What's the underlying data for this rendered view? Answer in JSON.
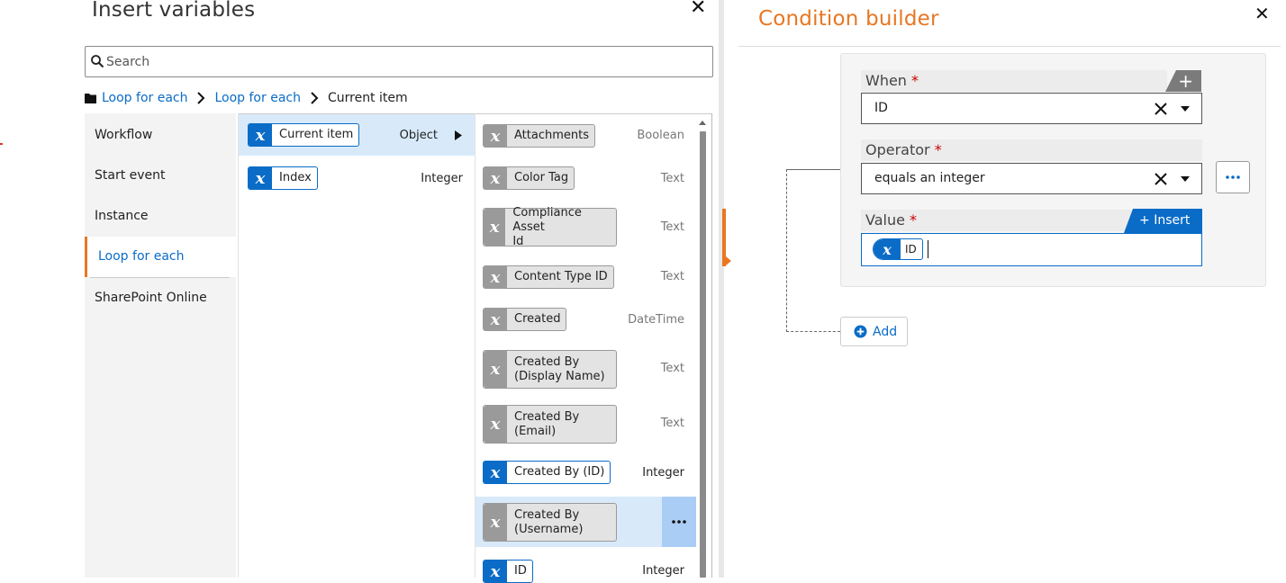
{
  "insert_variables": {
    "title": "Insert variables",
    "search_placeholder": "Search",
    "breadcrumb": [
      "Loop for each",
      "Loop for each",
      "Current item"
    ],
    "nav": [
      "Workflow",
      "Start event",
      "Instance",
      "Loop for each",
      "SharePoint Online"
    ],
    "col2": [
      {
        "label": "Current item",
        "type": "Object"
      },
      {
        "label": "Index",
        "type": "Integer"
      }
    ],
    "col3": [
      {
        "label": "Attachments",
        "type": "Boolean"
      },
      {
        "label": "Color Tag",
        "type": "Text"
      },
      {
        "label_l1": "Compliance Asset",
        "label_l2": "Id",
        "type": "Text"
      },
      {
        "label": "Content Type ID",
        "type": "Text"
      },
      {
        "label": "Created",
        "type": "DateTime"
      },
      {
        "label_l1": "Created By",
        "label_l2": "(Display Name)",
        "type": "Text"
      },
      {
        "label_l1": "Created By",
        "label_l2": "(Email)",
        "type": "Text"
      },
      {
        "label": "Created By (ID)",
        "type": "Integer"
      },
      {
        "label_l1": "Created By",
        "label_l2": "(Username)",
        "type": ""
      },
      {
        "label": "ID",
        "type": "Integer"
      }
    ]
  },
  "condition_builder": {
    "title": "Condition builder",
    "when_label": "When",
    "when_value": "ID",
    "operator_label": "Operator",
    "operator_value": "equals an integer",
    "value_label": "Value",
    "value_token": "ID",
    "insert_label": "Insert",
    "add_label": "Add",
    "required_mark": "*"
  },
  "colors": {
    "accent_blue": "#0a6cc7",
    "accent_orange": "#e87722",
    "highlight": "#d8eafa"
  }
}
